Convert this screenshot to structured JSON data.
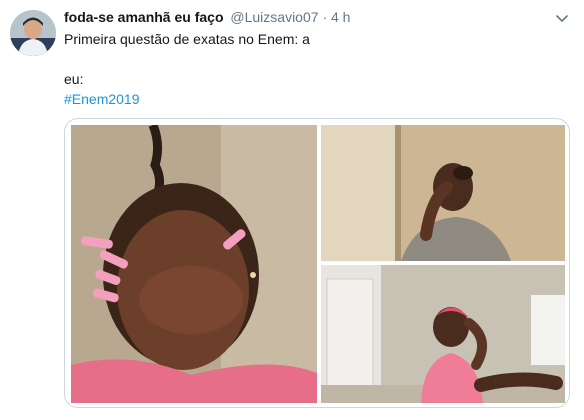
{
  "tweet": {
    "display_name": "foda-se amanhã eu faço",
    "handle": "@Luizsavio07",
    "separator": "·",
    "timestamp": "4 h",
    "text_line1": "Primeira questão de exatas no Enem: a",
    "text_line2": "eu:",
    "hashtag": "#Enem2019"
  },
  "icons": {
    "menu": "chevron-down-icon"
  },
  "colors": {
    "link": "#1b95e0",
    "muted": "#657786",
    "text": "#14171a",
    "border": "#ccd6dd"
  }
}
